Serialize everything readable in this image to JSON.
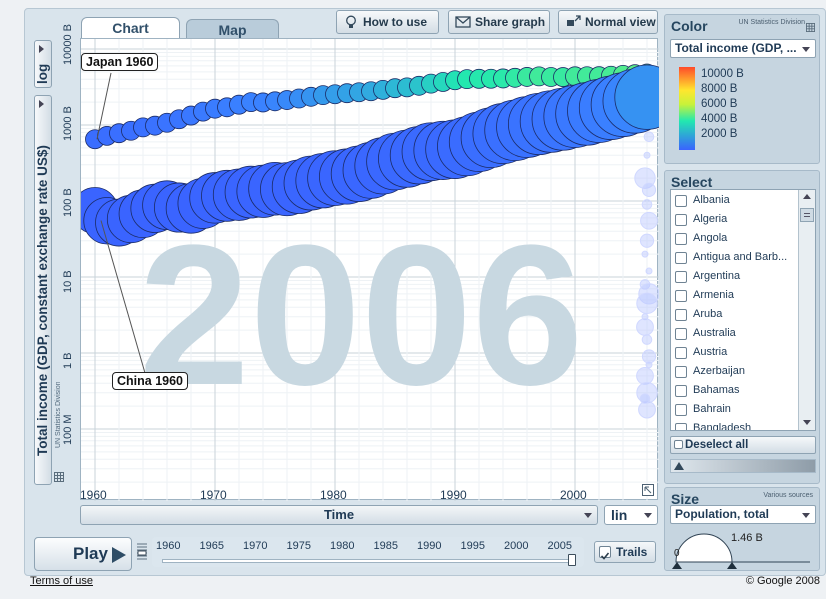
{
  "tabs": {
    "chart": "Chart",
    "map": "Map"
  },
  "toolbar": {
    "how_to_use": "How to use",
    "share_graph": "Share graph",
    "normal_view": "Normal view"
  },
  "y_axis": {
    "scale_label": "log",
    "title": "Total income (GDP, constant exchange rate US$)",
    "source": "UN Statistics Division"
  },
  "x_axis": {
    "title": "Time",
    "scale_label": "lin"
  },
  "watermark_year": "2006",
  "callouts": {
    "japan": "Japan 1960",
    "china": "China 1960"
  },
  "play": {
    "label": "Play"
  },
  "timeline": {
    "years": [
      "1960",
      "1965",
      "1970",
      "1975",
      "1980",
      "1985",
      "1990",
      "1995",
      "2000",
      "2005"
    ],
    "current_year": 2006
  },
  "trails": {
    "label": "Trails",
    "checked": true
  },
  "color_panel": {
    "title": "Color",
    "source": "UN Statistics Division",
    "indicator": "Total income (GDP, ...",
    "legend": [
      {
        "label": "10000 B",
        "color": "#ff4b2a"
      },
      {
        "label": "8000 B",
        "color": "#ffe62e"
      },
      {
        "label": "6000 B",
        "color": "#c8f23a"
      },
      {
        "label": "4000 B",
        "color": "#22e8b0"
      },
      {
        "label": "2000 B",
        "color": "#3a63ff"
      }
    ]
  },
  "select_panel": {
    "title": "Select",
    "countries": [
      "Albania",
      "Algeria",
      "Angola",
      "Antigua and Barb...",
      "Argentina",
      "Armenia",
      "Aruba",
      "Australia",
      "Austria",
      "Azerbaijan",
      "Bahamas",
      "Bahrain",
      "Bangladesh"
    ],
    "deselect_all": "Deselect all"
  },
  "size_panel": {
    "title": "Size",
    "source": "Various sources",
    "indicator": "Population, total",
    "min_label": "0",
    "max_label": "1.46 B"
  },
  "footer": {
    "terms": "Terms of use",
    "copyright": "© Google 2008"
  },
  "chart_data": {
    "type": "scatter",
    "x_scale": "linear",
    "y_scale": "log",
    "xlim": [
      1959,
      2007
    ],
    "ylim_label_range": [
      "100 M",
      "10000 B"
    ],
    "x_ticks": [
      "1960",
      "1970",
      "1980",
      "1990",
      "2000"
    ],
    "y_ticks": [
      "100 M",
      "1 B",
      "10 B",
      "100 B",
      "1000 B",
      "10000 B"
    ],
    "grid": true,
    "series": [
      {
        "name": "Japan",
        "x": [
          1960,
          1961,
          1962,
          1963,
          1964,
          1965,
          1966,
          1967,
          1968,
          1969,
          1970,
          1971,
          1972,
          1973,
          1974,
          1975,
          1976,
          1977,
          1978,
          1979,
          1980,
          1981,
          1982,
          1983,
          1984,
          1985,
          1986,
          1987,
          1988,
          1989,
          1990,
          1991,
          1992,
          1993,
          1994,
          1995,
          1996,
          1997,
          1998,
          1999,
          2000,
          2001,
          2002,
          2003,
          2004,
          2005,
          2006
        ],
        "y_billion": [
          650,
          720,
          780,
          840,
          930,
          980,
          1070,
          1190,
          1330,
          1500,
          1640,
          1710,
          1850,
          2000,
          1980,
          2050,
          2130,
          2230,
          2350,
          2470,
          2540,
          2620,
          2700,
          2780,
          2900,
          3050,
          3130,
          3280,
          3500,
          3680,
          3880,
          4010,
          4050,
          4060,
          4100,
          4180,
          4290,
          4360,
          4280,
          4270,
          4370,
          4380,
          4390,
          4450,
          4570,
          4660,
          4760
        ],
        "population_billion_start": 0.094,
        "population_billion_end": 0.128
      },
      {
        "name": "China",
        "x": [
          1960,
          1961,
          1962,
          1963,
          1964,
          1965,
          1966,
          1967,
          1968,
          1969,
          1970,
          1971,
          1972,
          1973,
          1974,
          1975,
          1976,
          1977,
          1978,
          1979,
          1980,
          1981,
          1982,
          1983,
          1984,
          1985,
          1986,
          1987,
          1988,
          1989,
          1990,
          1991,
          1992,
          1993,
          1994,
          1995,
          1996,
          1997,
          1998,
          1999,
          2000,
          2001,
          2002,
          2003,
          2004,
          2005,
          2006
        ],
        "y_billion": [
          75,
          55,
          52,
          58,
          68,
          80,
          88,
          82,
          80,
          93,
          110,
          117,
          121,
          131,
          134,
          145,
          143,
          154,
          172,
          185,
          200,
          210,
          228,
          253,
          290,
          330,
          360,
          400,
          445,
          463,
          480,
          525,
          600,
          680,
          770,
          850,
          940,
          1030,
          1110,
          1190,
          1300,
          1400,
          1530,
          1680,
          1850,
          2060,
          2320
        ],
        "population_billion_start": 0.667,
        "population_billion_end": 1.31
      }
    ]
  }
}
